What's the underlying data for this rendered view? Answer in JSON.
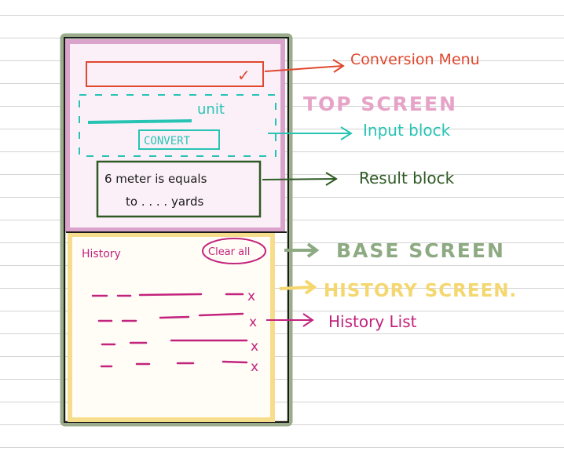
{
  "colors": {
    "phone_frame": "#9aac8c",
    "top_screen_fill": "#d9a3cc",
    "base_screen_fill": "#f6dd8c",
    "conversion_menu": "#e0472e",
    "input_block": "#27c4b4",
    "result_block": "#2e5a24",
    "history": "#c2237d",
    "top_screen_label": "#e6a3c7",
    "base_screen_label": "#8eaa82",
    "history_screen_label": "#f4d76f",
    "ink": "#1a1a1a"
  },
  "phone": {
    "menu_check": "✓",
    "unit_label": "unit",
    "convert_button": "CONVERT",
    "result_line1": "6 meter is equals",
    "result_line2": "to . . . . yards",
    "history_title": "History",
    "clear_all": "Clear all",
    "delete_mark": "x"
  },
  "annotations": {
    "conversion_menu": "Conversion Menu",
    "top_screen": "TOP SCREEN",
    "input_block": "Input block",
    "result_block": "Result block",
    "base_screen": "BASE SCREEN",
    "history_screen": "HISTORY SCREEN.",
    "history_list": "History List"
  }
}
